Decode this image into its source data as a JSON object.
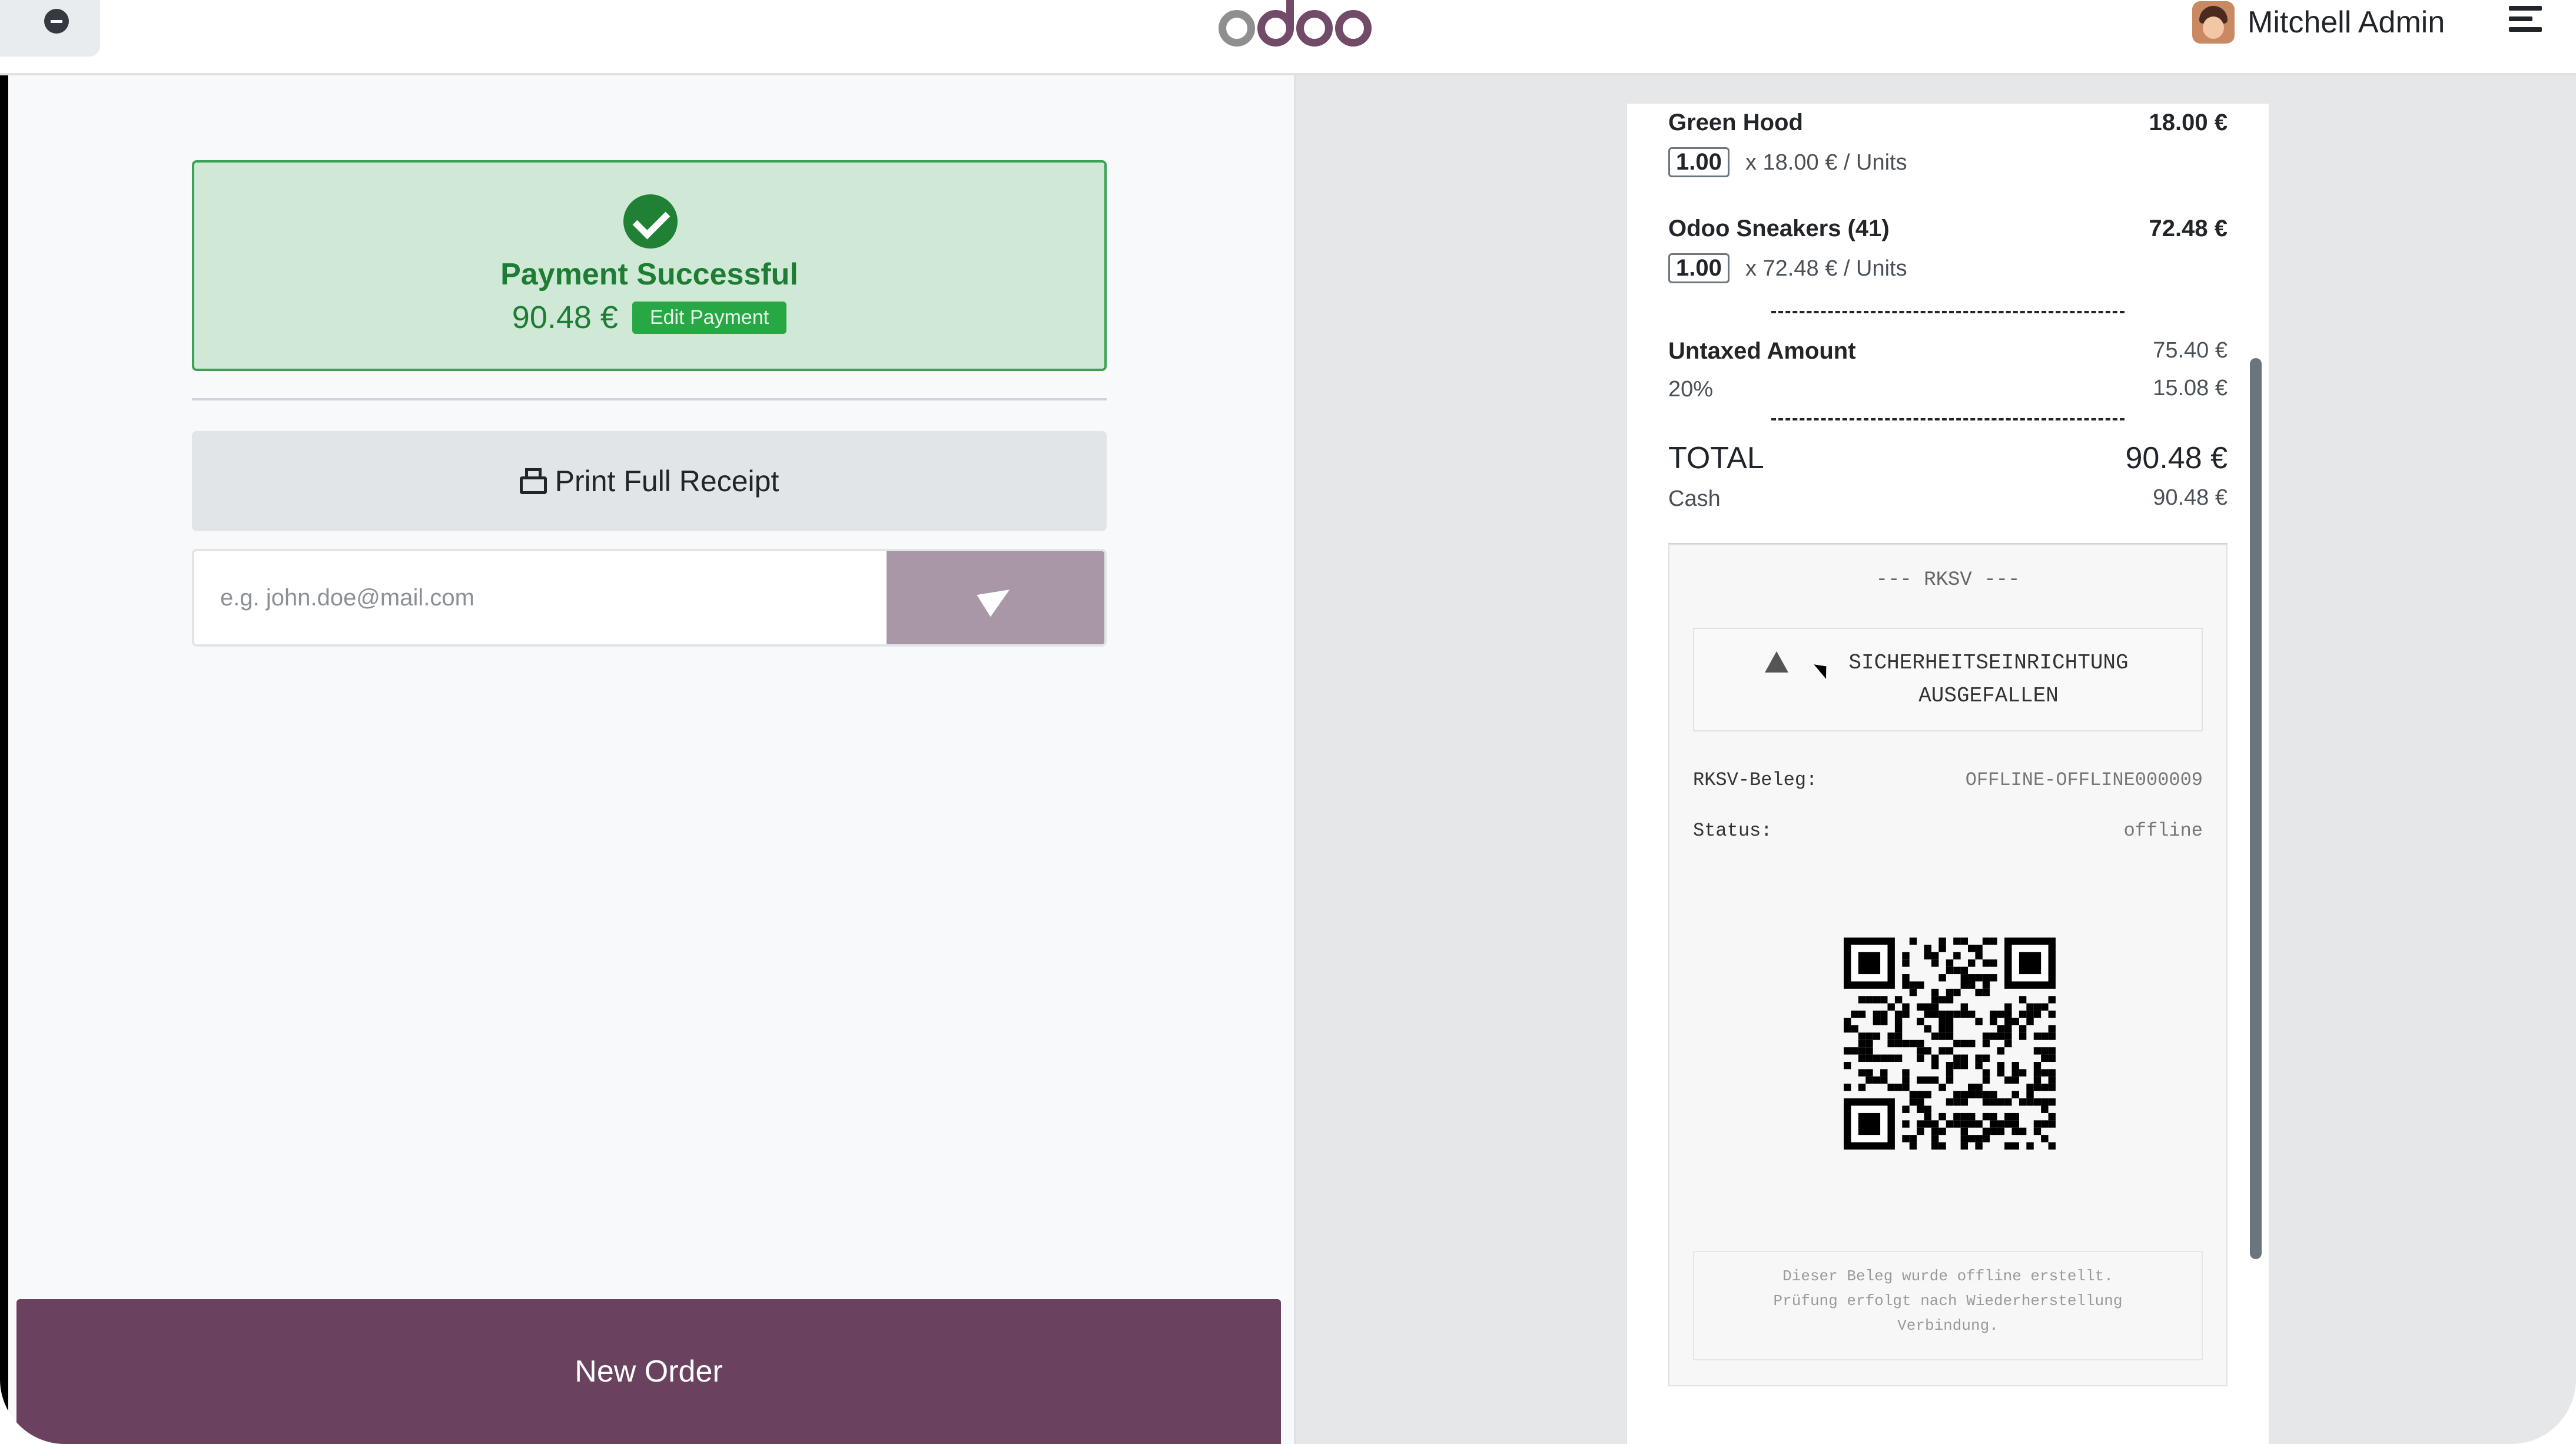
{
  "header": {
    "logo_text": "odoo",
    "user_name": "Mitchell Admin"
  },
  "payment": {
    "status_title": "Payment Successful",
    "amount": "90.48 €",
    "edit_label": "Edit Payment",
    "print_label": "Print Full Receipt",
    "email_placeholder": "e.g. john.doe@mail.com",
    "new_order_label": "New Order"
  },
  "receipt": {
    "lines": [
      {
        "name": "Green Hood",
        "price": "18.00 €",
        "qty": "1.00",
        "unit": "x 18.00 € / Units"
      },
      {
        "name": "Odoo Sneakers (41)",
        "price": "72.48 €",
        "qty": "1.00",
        "unit": "x 72.48 € / Units"
      }
    ],
    "untaxed_label": "Untaxed Amount",
    "untaxed_value": "75.40 €",
    "tax_label": "20%",
    "tax_value": "15.08 €",
    "total_label": "TOTAL",
    "total_value": "90.48 €",
    "cash_label": "Cash",
    "cash_value": "90.48 €",
    "tse": {
      "header": "--- RKSV ---",
      "warning_line1": "SICHERHEITSEINRICHTUNG",
      "warning_line2": "AUSGEFALLEN",
      "beleg_label": "RKSV-Beleg:",
      "beleg_value": "OFFLINE-OFFLINE000009",
      "status_label": "Status:",
      "status_value": "offline",
      "footer_line1": "Dieser Beleg wurde offline erstellt.",
      "footer_line2": "Prüfung erfolgt nach Wiederherstellung",
      "footer_line3": "Verbindung."
    }
  },
  "colors": {
    "brand": "#714b67",
    "success": "#28a745",
    "send": "#a996a6"
  }
}
